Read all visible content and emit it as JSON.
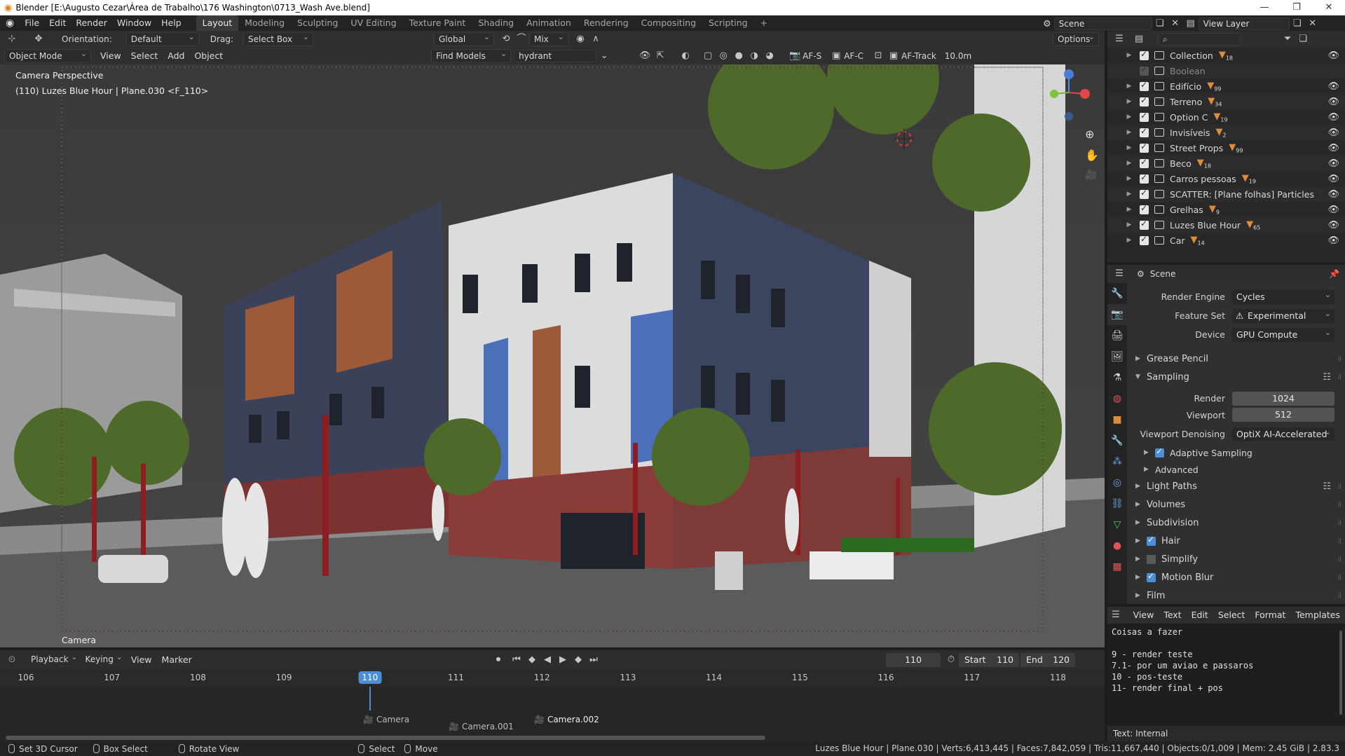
{
  "window": {
    "title": "Blender [E:\\Augusto Cezar\\Área de Trabalho\\176 Washington\\0713_Wash Ave.blend]"
  },
  "menu": [
    "File",
    "Edit",
    "Render",
    "Window",
    "Help"
  ],
  "workspaces": [
    "Layout",
    "Modeling",
    "Sculpting",
    "UV Editing",
    "Texture Paint",
    "Shading",
    "Animation",
    "Rendering",
    "Compositing",
    "Scripting"
  ],
  "active_workspace": "Layout",
  "scene_selector": "Scene",
  "view_layer": "View Layer",
  "vp_header": {
    "orientation_label": "Orientation:",
    "orientation_value": "Default",
    "drag_label": "Drag:",
    "drag_value": "Select Box",
    "transform_orientation": "Global",
    "snap_mix": "Mix",
    "options": "Options"
  },
  "vp_header2": {
    "mode": "Object Mode",
    "menus": [
      "View",
      "Select",
      "Add",
      "Object"
    ],
    "find_models": "Find Models",
    "search_value": "hydrant",
    "af_s": "AF-S",
    "af_c": "AF-C",
    "af_track": "AF-Track",
    "distance": "10.0m"
  },
  "viewport": {
    "overlay_line1": "Camera Perspective",
    "overlay_line2": "(110) Luzes Blue Hour | Plane.030 <F_110>",
    "camera_label": "Camera"
  },
  "outliner": {
    "search_placeholder": "",
    "items": [
      {
        "name": "Collection",
        "count": "18",
        "checked": true
      },
      {
        "name": "Boolean",
        "count": "",
        "checked": false
      },
      {
        "name": "Edifício",
        "count": "99",
        "checked": true
      },
      {
        "name": "Terreno",
        "count": "34",
        "checked": true
      },
      {
        "name": "Option C",
        "count": "19",
        "checked": true
      },
      {
        "name": "Invisíveis",
        "count": "2",
        "checked": true
      },
      {
        "name": "Street Props",
        "count": "99",
        "checked": true
      },
      {
        "name": "Beco",
        "count": "18",
        "checked": true
      },
      {
        "name": "Carros pessoas",
        "count": "19",
        "checked": true
      },
      {
        "name": "SCATTER: [Plane folhas] Particles",
        "count": "",
        "checked": true
      },
      {
        "name": "Grelhas",
        "count": "9",
        "checked": true
      },
      {
        "name": "Luzes Blue Hour",
        "count": "65",
        "checked": true
      },
      {
        "name": "Car",
        "count": "14",
        "checked": true
      }
    ]
  },
  "properties": {
    "context": "Scene",
    "render_engine_label": "Render Engine",
    "render_engine": "Cycles",
    "feature_set_label": "Feature Set",
    "feature_set": "Experimental",
    "device_label": "Device",
    "device": "GPU Compute",
    "sections": {
      "grease_pencil": "Grease Pencil",
      "sampling": "Sampling",
      "render_label": "Render",
      "render_value": "1024",
      "viewport_label": "Viewport",
      "viewport_value": "512",
      "denoise_label": "Viewport Denoising",
      "denoise_value": "OptiX AI-Accelerated",
      "adaptive": "Adaptive Sampling",
      "advanced": "Advanced",
      "light_paths": "Light Paths",
      "volumes": "Volumes",
      "subdivision": "Subdivision",
      "hair": "Hair",
      "simplify": "Simplify",
      "motion_blur": "Motion Blur",
      "film": "Film"
    }
  },
  "text_editor": {
    "menus": [
      "View",
      "Text",
      "Edit",
      "Select",
      "Format",
      "Templates"
    ],
    "lines": [
      "Coisas a fazer",
      "",
      "9 - render teste",
      "7.1- por um aviao e passaros",
      "10 - pos-teste",
      "11- render final + pos"
    ],
    "footer": "Text: Internal"
  },
  "timeline": {
    "menus": [
      "Playback",
      "Keying",
      "View",
      "Marker"
    ],
    "current_frame": "110",
    "start_label": "Start",
    "start": "110",
    "end_label": "End",
    "end": "120",
    "ticks": [
      "106",
      "107",
      "108",
      "109",
      "110",
      "111",
      "112",
      "113",
      "114",
      "115",
      "116",
      "117",
      "118"
    ],
    "markers": [
      "Camera",
      "Camera.001",
      "Camera.002"
    ]
  },
  "status": {
    "hints": [
      "Set 3D Cursor",
      "Box Select",
      "Rotate View",
      "Select",
      "Move"
    ],
    "info": "Luzes Blue Hour | Plane.030 | Verts:6,413,445 | Faces:7,842,059 | Tris:11,667,440 | Objects:0/1,009 | Mem: 2.45 GiB | 2.83.3"
  }
}
